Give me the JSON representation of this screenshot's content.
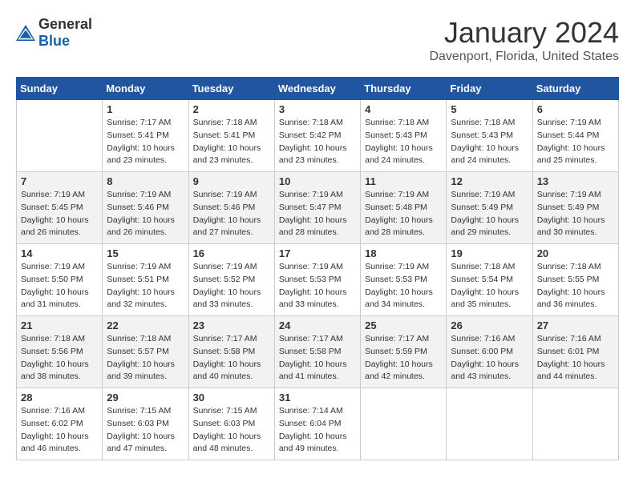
{
  "header": {
    "logo_general": "General",
    "logo_blue": "Blue",
    "month": "January 2024",
    "location": "Davenport, Florida, United States"
  },
  "days_of_week": [
    "Sunday",
    "Monday",
    "Tuesday",
    "Wednesday",
    "Thursday",
    "Friday",
    "Saturday"
  ],
  "weeks": [
    [
      {
        "day": "",
        "sunrise": "",
        "sunset": "",
        "daylight": ""
      },
      {
        "day": "1",
        "sunrise": "Sunrise: 7:17 AM",
        "sunset": "Sunset: 5:41 PM",
        "daylight": "Daylight: 10 hours and 23 minutes."
      },
      {
        "day": "2",
        "sunrise": "Sunrise: 7:18 AM",
        "sunset": "Sunset: 5:41 PM",
        "daylight": "Daylight: 10 hours and 23 minutes."
      },
      {
        "day": "3",
        "sunrise": "Sunrise: 7:18 AM",
        "sunset": "Sunset: 5:42 PM",
        "daylight": "Daylight: 10 hours and 23 minutes."
      },
      {
        "day": "4",
        "sunrise": "Sunrise: 7:18 AM",
        "sunset": "Sunset: 5:43 PM",
        "daylight": "Daylight: 10 hours and 24 minutes."
      },
      {
        "day": "5",
        "sunrise": "Sunrise: 7:18 AM",
        "sunset": "Sunset: 5:43 PM",
        "daylight": "Daylight: 10 hours and 24 minutes."
      },
      {
        "day": "6",
        "sunrise": "Sunrise: 7:19 AM",
        "sunset": "Sunset: 5:44 PM",
        "daylight": "Daylight: 10 hours and 25 minutes."
      }
    ],
    [
      {
        "day": "7",
        "sunrise": "Sunrise: 7:19 AM",
        "sunset": "Sunset: 5:45 PM",
        "daylight": "Daylight: 10 hours and 26 minutes."
      },
      {
        "day": "8",
        "sunrise": "Sunrise: 7:19 AM",
        "sunset": "Sunset: 5:46 PM",
        "daylight": "Daylight: 10 hours and 26 minutes."
      },
      {
        "day": "9",
        "sunrise": "Sunrise: 7:19 AM",
        "sunset": "Sunset: 5:46 PM",
        "daylight": "Daylight: 10 hours and 27 minutes."
      },
      {
        "day": "10",
        "sunrise": "Sunrise: 7:19 AM",
        "sunset": "Sunset: 5:47 PM",
        "daylight": "Daylight: 10 hours and 28 minutes."
      },
      {
        "day": "11",
        "sunrise": "Sunrise: 7:19 AM",
        "sunset": "Sunset: 5:48 PM",
        "daylight": "Daylight: 10 hours and 28 minutes."
      },
      {
        "day": "12",
        "sunrise": "Sunrise: 7:19 AM",
        "sunset": "Sunset: 5:49 PM",
        "daylight": "Daylight: 10 hours and 29 minutes."
      },
      {
        "day": "13",
        "sunrise": "Sunrise: 7:19 AM",
        "sunset": "Sunset: 5:49 PM",
        "daylight": "Daylight: 10 hours and 30 minutes."
      }
    ],
    [
      {
        "day": "14",
        "sunrise": "Sunrise: 7:19 AM",
        "sunset": "Sunset: 5:50 PM",
        "daylight": "Daylight: 10 hours and 31 minutes."
      },
      {
        "day": "15",
        "sunrise": "Sunrise: 7:19 AM",
        "sunset": "Sunset: 5:51 PM",
        "daylight": "Daylight: 10 hours and 32 minutes."
      },
      {
        "day": "16",
        "sunrise": "Sunrise: 7:19 AM",
        "sunset": "Sunset: 5:52 PM",
        "daylight": "Daylight: 10 hours and 33 minutes."
      },
      {
        "day": "17",
        "sunrise": "Sunrise: 7:19 AM",
        "sunset": "Sunset: 5:53 PM",
        "daylight": "Daylight: 10 hours and 33 minutes."
      },
      {
        "day": "18",
        "sunrise": "Sunrise: 7:19 AM",
        "sunset": "Sunset: 5:53 PM",
        "daylight": "Daylight: 10 hours and 34 minutes."
      },
      {
        "day": "19",
        "sunrise": "Sunrise: 7:18 AM",
        "sunset": "Sunset: 5:54 PM",
        "daylight": "Daylight: 10 hours and 35 minutes."
      },
      {
        "day": "20",
        "sunrise": "Sunrise: 7:18 AM",
        "sunset": "Sunset: 5:55 PM",
        "daylight": "Daylight: 10 hours and 36 minutes."
      }
    ],
    [
      {
        "day": "21",
        "sunrise": "Sunrise: 7:18 AM",
        "sunset": "Sunset: 5:56 PM",
        "daylight": "Daylight: 10 hours and 38 minutes."
      },
      {
        "day": "22",
        "sunrise": "Sunrise: 7:18 AM",
        "sunset": "Sunset: 5:57 PM",
        "daylight": "Daylight: 10 hours and 39 minutes."
      },
      {
        "day": "23",
        "sunrise": "Sunrise: 7:17 AM",
        "sunset": "Sunset: 5:58 PM",
        "daylight": "Daylight: 10 hours and 40 minutes."
      },
      {
        "day": "24",
        "sunrise": "Sunrise: 7:17 AM",
        "sunset": "Sunset: 5:58 PM",
        "daylight": "Daylight: 10 hours and 41 minutes."
      },
      {
        "day": "25",
        "sunrise": "Sunrise: 7:17 AM",
        "sunset": "Sunset: 5:59 PM",
        "daylight": "Daylight: 10 hours and 42 minutes."
      },
      {
        "day": "26",
        "sunrise": "Sunrise: 7:16 AM",
        "sunset": "Sunset: 6:00 PM",
        "daylight": "Daylight: 10 hours and 43 minutes."
      },
      {
        "day": "27",
        "sunrise": "Sunrise: 7:16 AM",
        "sunset": "Sunset: 6:01 PM",
        "daylight": "Daylight: 10 hours and 44 minutes."
      }
    ],
    [
      {
        "day": "28",
        "sunrise": "Sunrise: 7:16 AM",
        "sunset": "Sunset: 6:02 PM",
        "daylight": "Daylight: 10 hours and 46 minutes."
      },
      {
        "day": "29",
        "sunrise": "Sunrise: 7:15 AM",
        "sunset": "Sunset: 6:03 PM",
        "daylight": "Daylight: 10 hours and 47 minutes."
      },
      {
        "day": "30",
        "sunrise": "Sunrise: 7:15 AM",
        "sunset": "Sunset: 6:03 PM",
        "daylight": "Daylight: 10 hours and 48 minutes."
      },
      {
        "day": "31",
        "sunrise": "Sunrise: 7:14 AM",
        "sunset": "Sunset: 6:04 PM",
        "daylight": "Daylight: 10 hours and 49 minutes."
      },
      {
        "day": "",
        "sunrise": "",
        "sunset": "",
        "daylight": ""
      },
      {
        "day": "",
        "sunrise": "",
        "sunset": "",
        "daylight": ""
      },
      {
        "day": "",
        "sunrise": "",
        "sunset": "",
        "daylight": ""
      }
    ]
  ]
}
